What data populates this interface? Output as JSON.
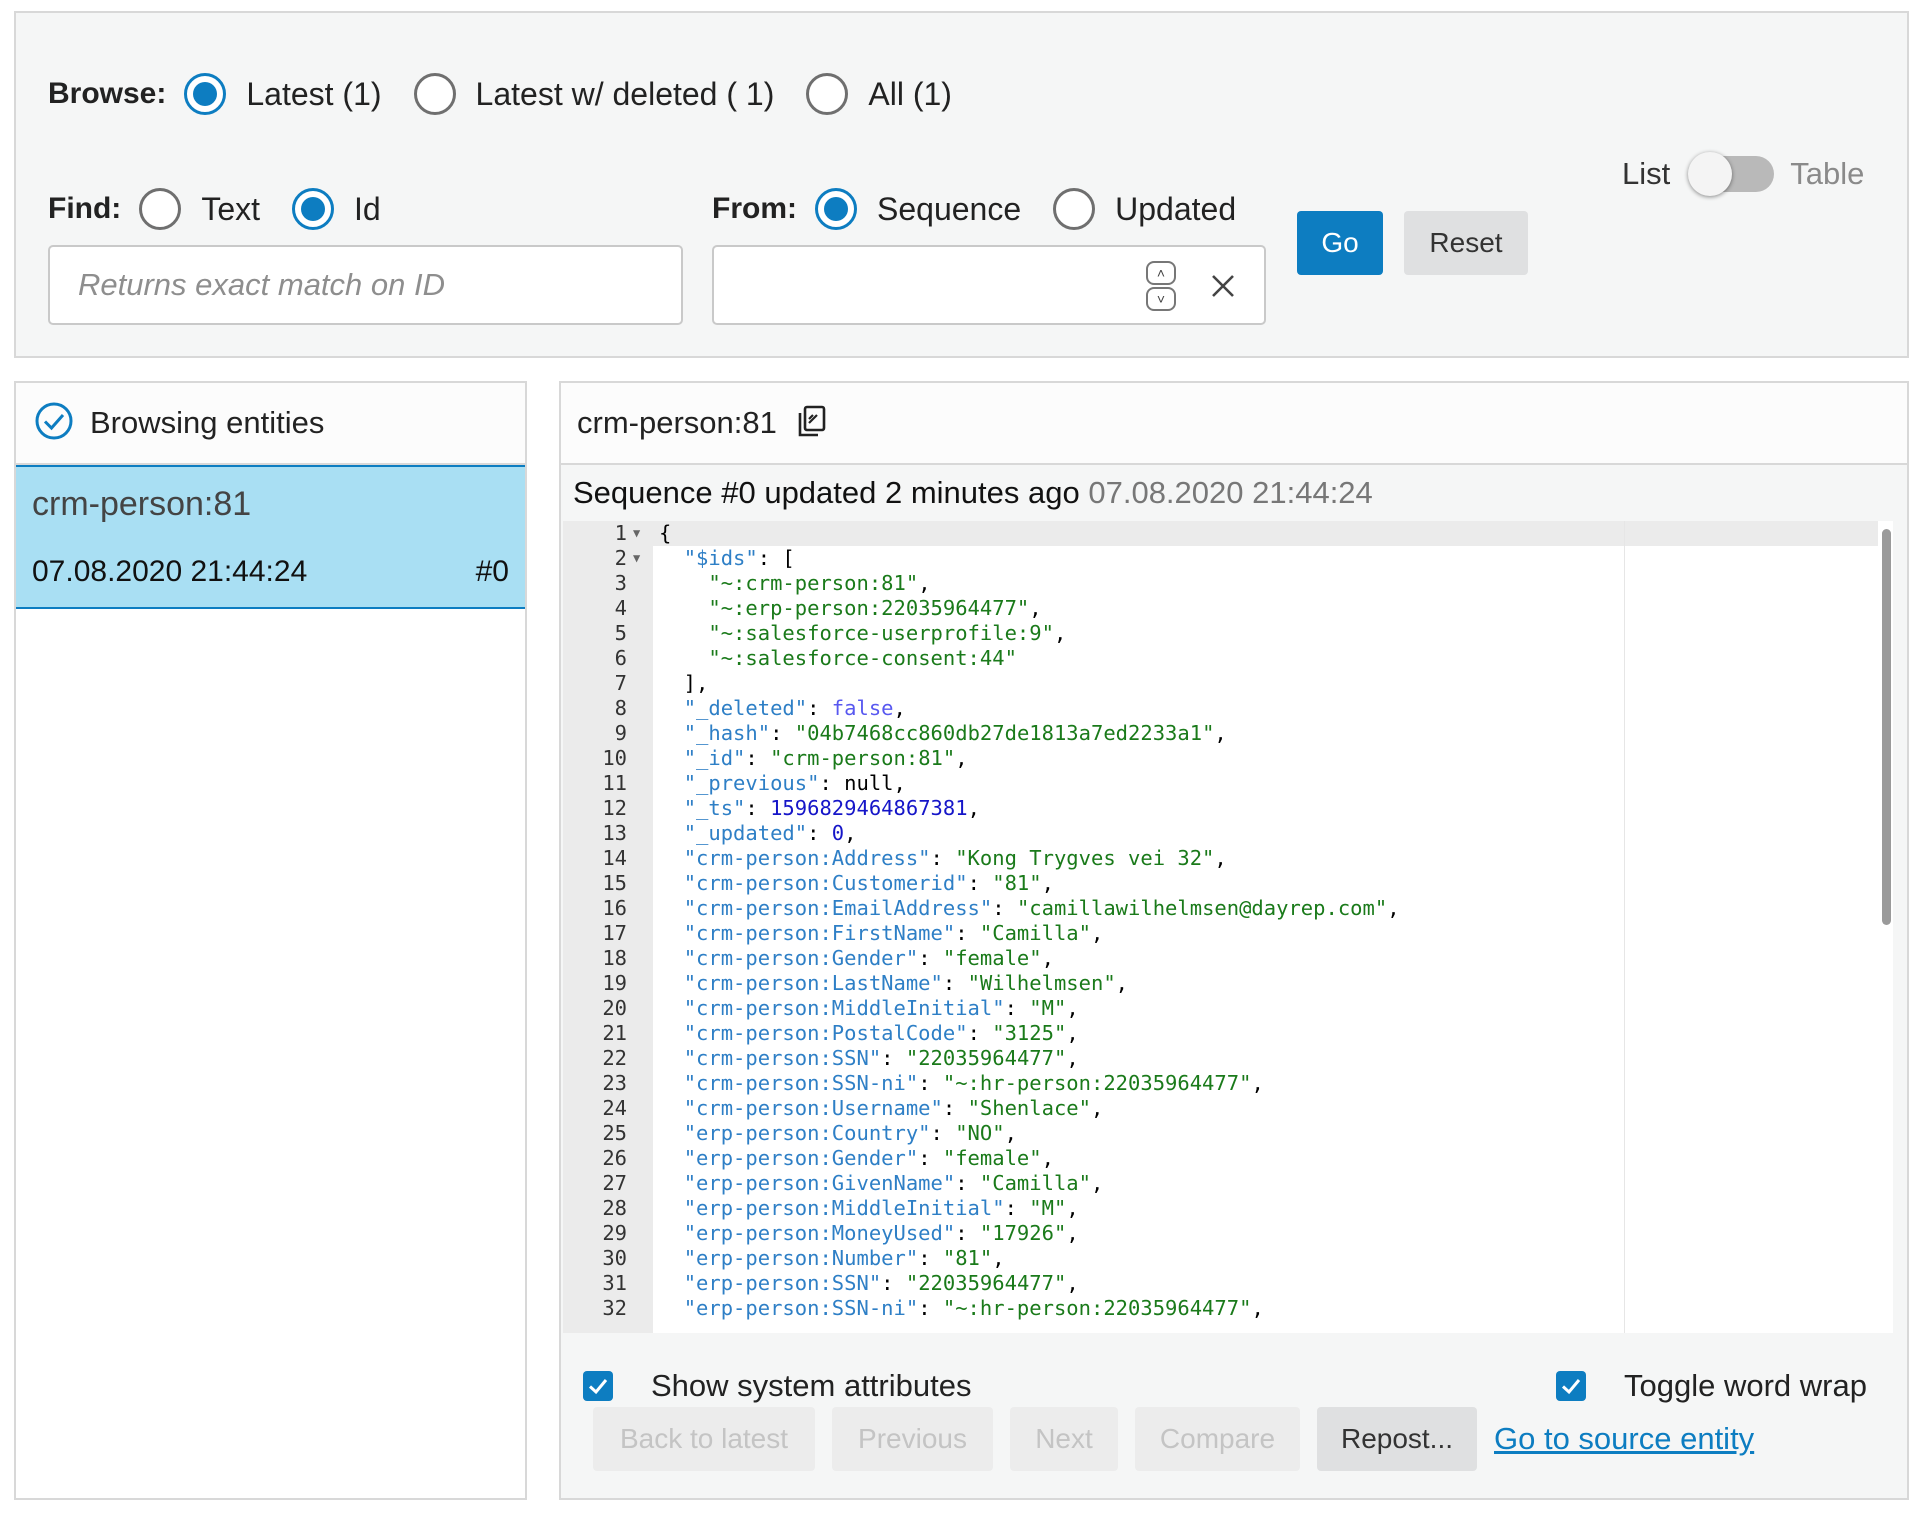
{
  "filters": {
    "browse_label": "Browse:",
    "browse_options": [
      {
        "label": "Latest (1)",
        "selected": true
      },
      {
        "label": "Latest w/ deleted ( 1)",
        "selected": false
      },
      {
        "label": "All (1)",
        "selected": false
      }
    ],
    "find_label": "Find:",
    "find_options": [
      {
        "label": "Text",
        "selected": false
      },
      {
        "label": "Id",
        "selected": true
      }
    ],
    "find_placeholder": "Returns exact match on ID",
    "from_label": "From:",
    "from_options": [
      {
        "label": "Sequence",
        "selected": true
      },
      {
        "label": "Updated",
        "selected": false
      }
    ],
    "sequence_value": "",
    "go_label": "Go",
    "reset_label": "Reset",
    "view_list_label": "List",
    "view_table_label": "Table"
  },
  "left_panel": {
    "title": "Browsing entities",
    "entities": [
      {
        "id": "crm-person:81",
        "timestamp": "07.08.2020 21:44:24",
        "sequence": "#0",
        "selected": true
      }
    ]
  },
  "detail": {
    "entity_id": "crm-person:81",
    "sequence_text": "Sequence #0 updated 2 minutes ago",
    "sequence_date": "07.08.2020 21:44:24",
    "code_lines": [
      "{",
      "  \"$ids\": [",
      "    \"~:crm-person:81\",",
      "    \"~:erp-person:22035964477\",",
      "    \"~:salesforce-userprofile:9\",",
      "    \"~:salesforce-consent:44\"",
      "  ],",
      "  \"_deleted\": false,",
      "  \"_hash\": \"04b7468cc860db27de1813a7ed2233a1\",",
      "  \"_id\": \"crm-person:81\",",
      "  \"_previous\": null,",
      "  \"_ts\": 1596829464867381,",
      "  \"_updated\": 0,",
      "  \"crm-person:Address\": \"Kong Trygves vei 32\",",
      "  \"crm-person:Customerid\": \"81\",",
      "  \"crm-person:EmailAddress\": \"camillawilhelmsen@dayrep.com\",",
      "  \"crm-person:FirstName\": \"Camilla\",",
      "  \"crm-person:Gender\": \"female\",",
      "  \"crm-person:LastName\": \"Wilhelmsen\",",
      "  \"crm-person:MiddleInitial\": \"M\",",
      "  \"crm-person:PostalCode\": \"3125\",",
      "  \"crm-person:SSN\": \"22035964477\",",
      "  \"crm-person:SSN-ni\": \"~:hr-person:22035964477\",",
      "  \"crm-person:Username\": \"Shenlace\",",
      "  \"erp-person:Country\": \"NO\",",
      "  \"erp-person:Gender\": \"female\",",
      "  \"erp-person:GivenName\": \"Camilla\",",
      "  \"erp-person:MiddleInitial\": \"M\",",
      "  \"erp-person:MoneyUsed\": \"17926\",",
      "  \"erp-person:Number\": \"81\",",
      "  \"erp-person:SSN\": \"22035964477\",",
      "  \"erp-person:SSN-ni\": \"~:hr-person:22035964477\","
    ],
    "folded_lines": [
      1,
      2
    ],
    "show_system_attributes_label": "Show system attributes",
    "show_system_attributes_checked": true,
    "word_wrap_label": "Toggle word wrap",
    "word_wrap_checked": true,
    "buttons": {
      "back_to_latest": "Back to latest",
      "previous": "Previous",
      "next": "Next",
      "compare": "Compare",
      "repost": "Repost...",
      "go_to_source": "Go to source entity"
    }
  },
  "colors": {
    "accent": "#0d7dc1",
    "selected_row": "#a9dff3",
    "json_key": "#2e7fc6",
    "json_string": "#1a7a1a",
    "json_boolean": "#5858f0",
    "json_number": "#1515c8"
  },
  "icons": {
    "browse_header_icon": "check-circle-icon",
    "copy_icon": "copy-icon",
    "clear_icon": "close-icon",
    "stepper_icon": "chevron-up-down-icon"
  }
}
